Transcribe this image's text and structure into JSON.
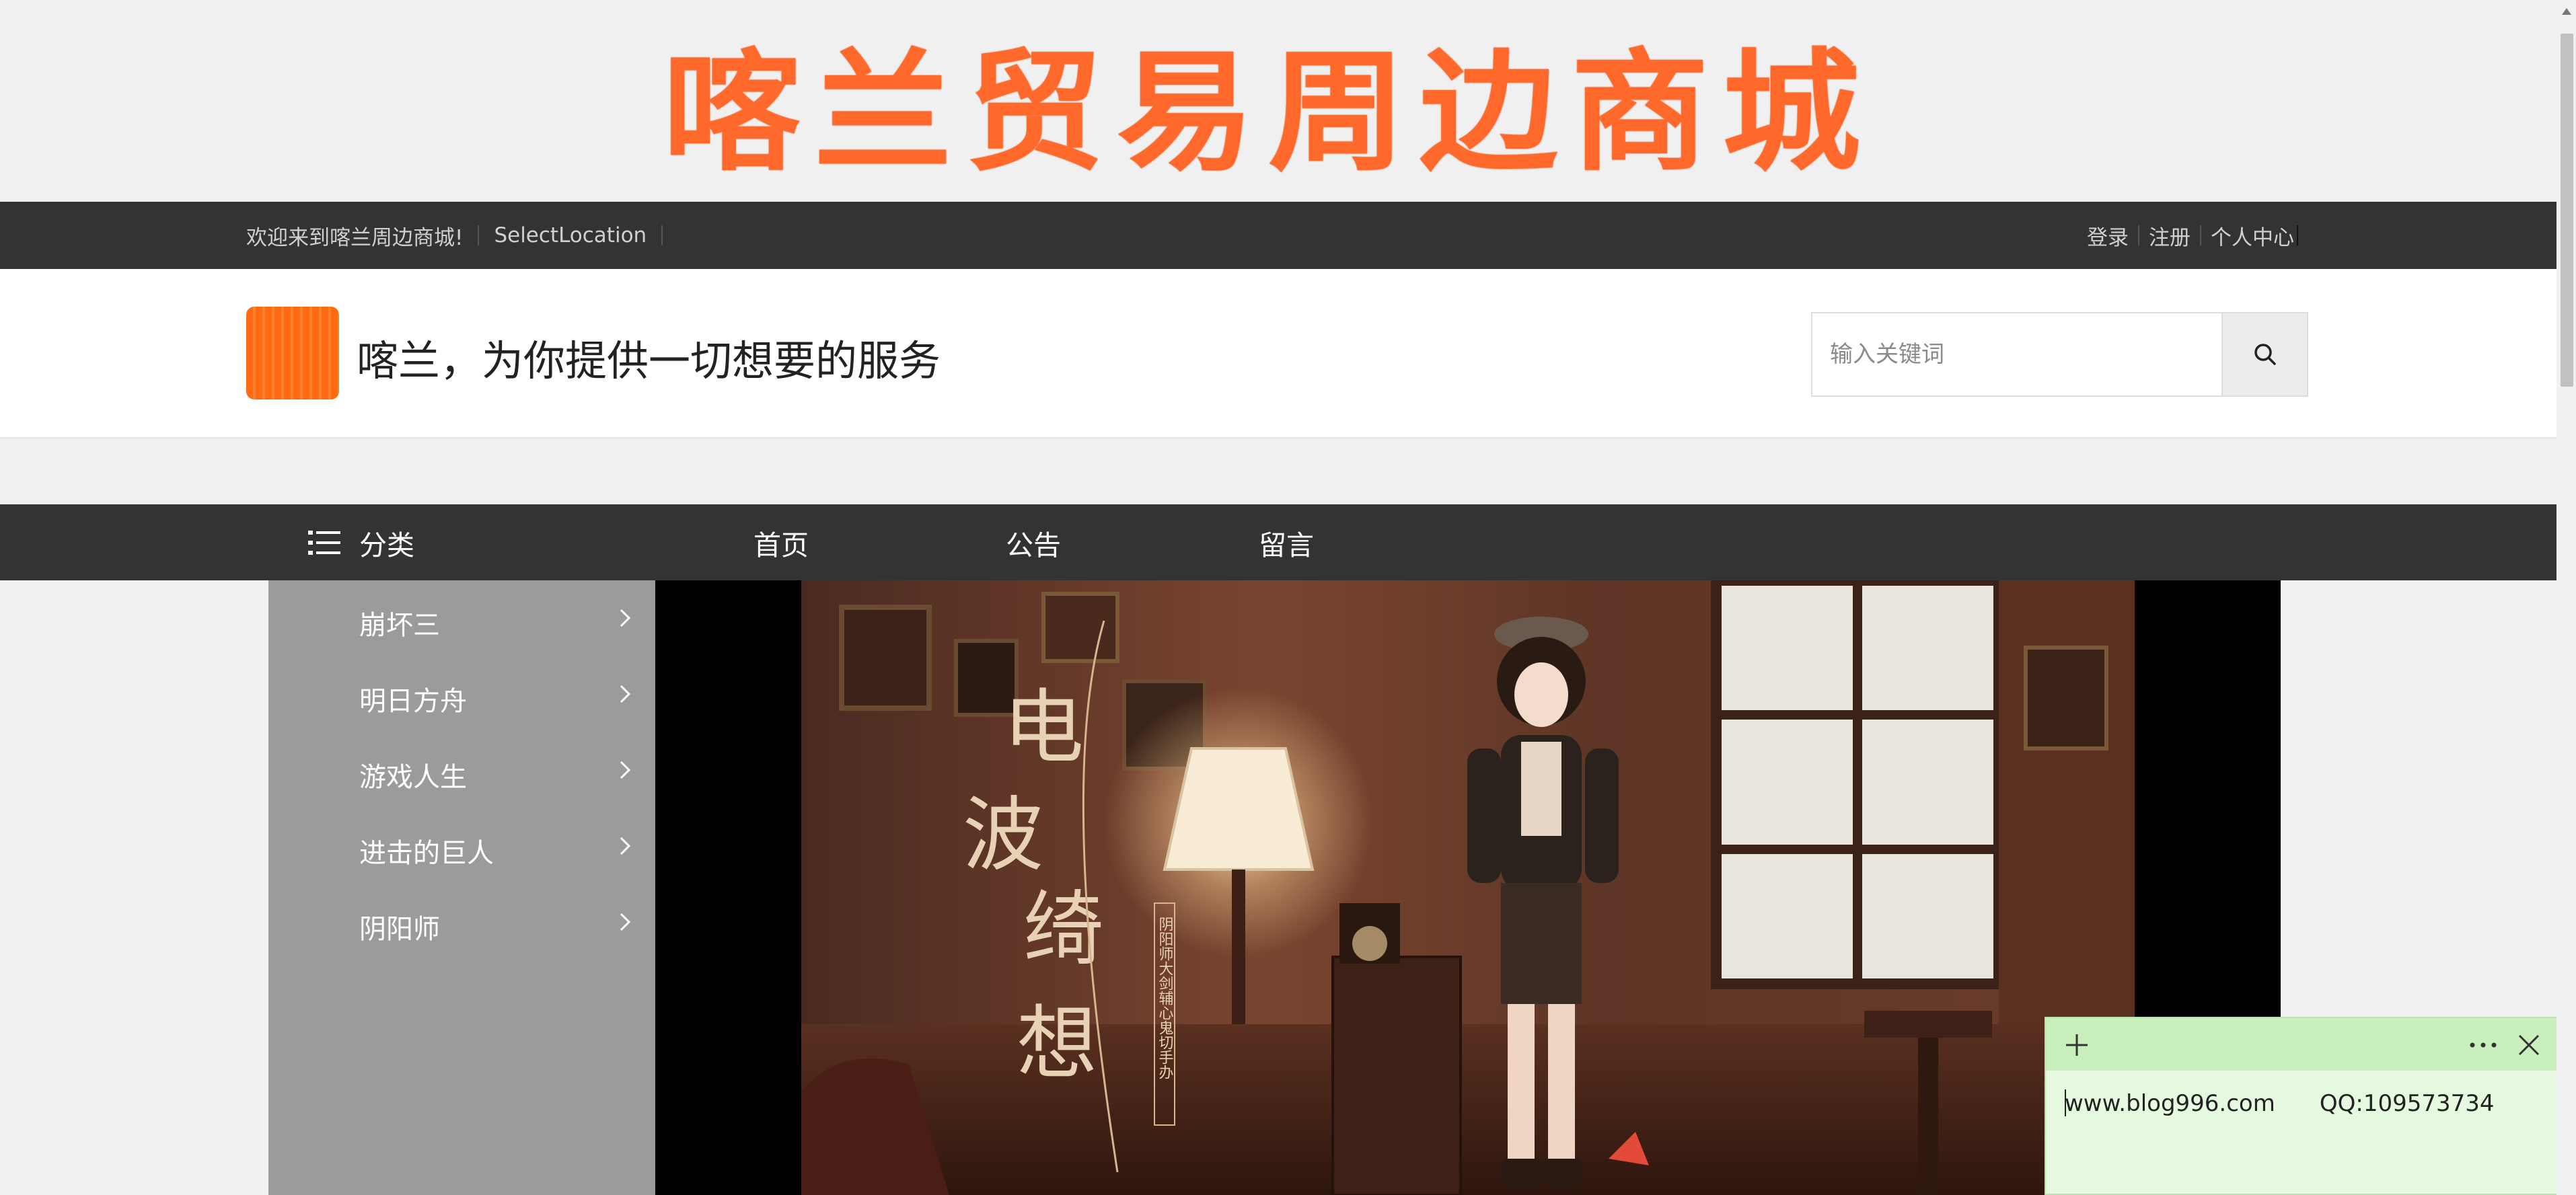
{
  "banner": {
    "title": "喀兰贸易周边商城"
  },
  "topbar": {
    "welcome": "欢迎来到喀兰周边商城!",
    "location": "SelectLocation",
    "login": "登录",
    "register": "注册",
    "user_center": "个人中心"
  },
  "header": {
    "slogan": "喀兰，为你提供一切想要的服务",
    "search_placeholder": "输入关键词"
  },
  "nav": {
    "category": "分类",
    "links": [
      "首页",
      "公告",
      "留言"
    ]
  },
  "sidebar": {
    "items": [
      {
        "label": "崩坏三"
      },
      {
        "label": "明日方舟"
      },
      {
        "label": "游戏人生"
      },
      {
        "label": "进击的巨人"
      },
      {
        "label": "阴阳师"
      }
    ]
  },
  "slide": {
    "big_text": [
      "电",
      "波",
      "绮",
      "想"
    ],
    "small_text": "阴阳师大剑辅心鬼切手办"
  },
  "note": {
    "site": "www.blog996.com",
    "qq": "QQ:109573734"
  },
  "colors": {
    "brand_orange": "#ff6a2c",
    "dark_bar": "#333333",
    "sidebar_gray": "#9c9a9c",
    "note_green": "#e6f8e0"
  }
}
